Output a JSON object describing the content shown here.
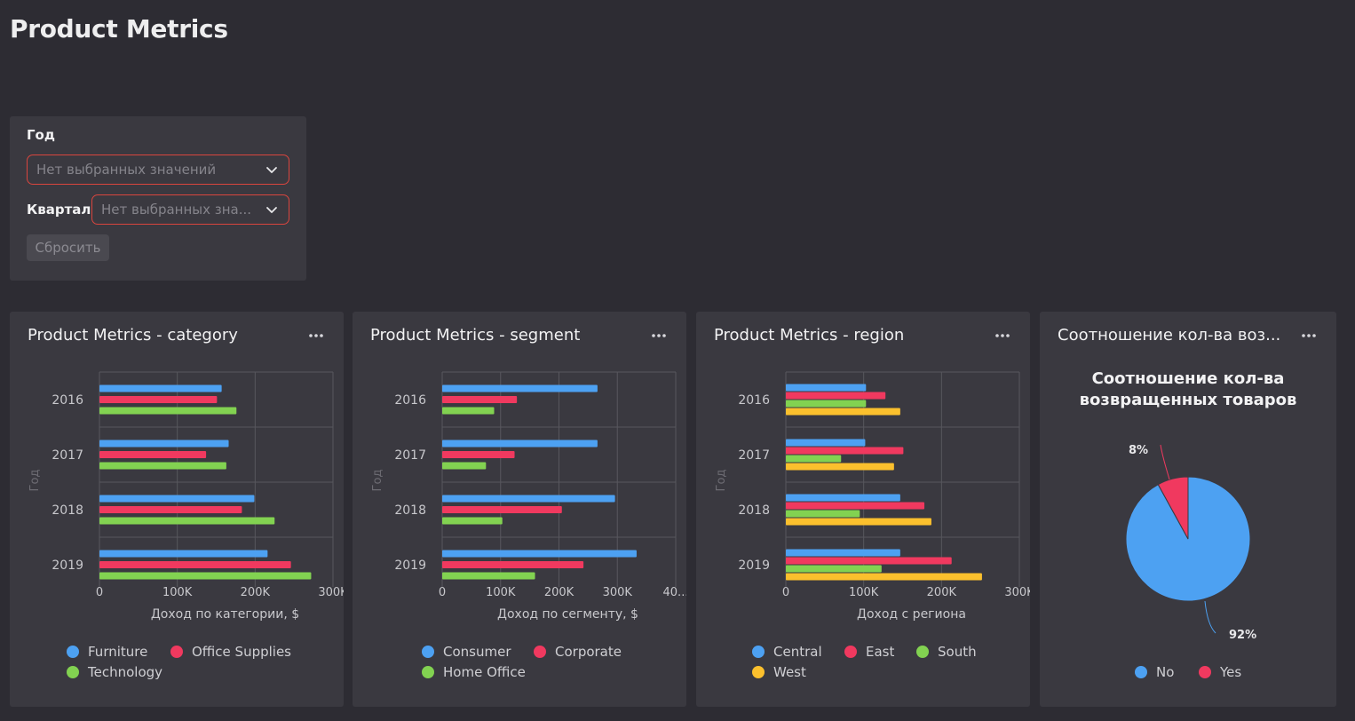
{
  "page": {
    "title": "Product Metrics"
  },
  "filters": {
    "year_label": "Год",
    "year_placeholder": "Нет выбранных значений",
    "quarter_label": "Квартал",
    "quarter_placeholder": "Нет выбранных зна...",
    "reset_label": "Сбросить"
  },
  "cards": {
    "category": {
      "title": "Product Metrics - category"
    },
    "segment": {
      "title": "Product Metrics - segment"
    },
    "region": {
      "title": "Product Metrics - region"
    },
    "returns": {
      "title": "Соотношение кол-ва воз..."
    }
  },
  "colors": {
    "blue": "#4da1f2",
    "red": "#f0395f",
    "green": "#82d251",
    "yellow": "#fbc02d",
    "grid": "#58575e",
    "axis_text": "#c8c8cc",
    "ylabel_text": "#6d6c73"
  },
  "chart_data": [
    {
      "id": "category",
      "type": "bar",
      "orientation": "horizontal",
      "categories": [
        "2016",
        "2017",
        "2018",
        "2019"
      ],
      "series": [
        {
          "name": "Furniture",
          "color": "#4da1f2",
          "values": [
            157000,
            166000,
            199000,
            216000
          ]
        },
        {
          "name": "Office Supplies",
          "color": "#f0395f",
          "values": [
            151000,
            137000,
            183000,
            246000
          ]
        },
        {
          "name": "Technology",
          "color": "#82d251",
          "values": [
            176000,
            163000,
            225000,
            272000
          ]
        }
      ],
      "xlabel": "Доход по категории, $",
      "ylabel": "Год",
      "xlim": [
        0,
        300000
      ],
      "xticks": [
        "0",
        "100K",
        "200K",
        "300K"
      ],
      "grid": true,
      "legend_position": "bottom"
    },
    {
      "id": "segment",
      "type": "bar",
      "orientation": "horizontal",
      "categories": [
        "2016",
        "2017",
        "2018",
        "2019"
      ],
      "series": [
        {
          "name": "Consumer",
          "color": "#4da1f2",
          "values": [
            266000,
            266000,
            296000,
            333000
          ]
        },
        {
          "name": "Corporate",
          "color": "#f0395f",
          "values": [
            128000,
            124000,
            205000,
            242000
          ]
        },
        {
          "name": "Home Office",
          "color": "#82d251",
          "values": [
            89000,
            75000,
            103000,
            159000
          ]
        }
      ],
      "xlabel": "Доход по сегменту, $",
      "ylabel": "Год",
      "xlim": [
        0,
        400000
      ],
      "xticks": [
        "0",
        "100K",
        "200K",
        "300K",
        "40..."
      ],
      "grid": true,
      "legend_position": "bottom"
    },
    {
      "id": "region",
      "type": "bar",
      "orientation": "horizontal",
      "categories": [
        "2016",
        "2017",
        "2018",
        "2019"
      ],
      "series": [
        {
          "name": "Central",
          "color": "#4da1f2",
          "values": [
            103000,
            102000,
            147000,
            147000
          ]
        },
        {
          "name": "East",
          "color": "#f0395f",
          "values": [
            128000,
            151000,
            178000,
            213000
          ]
        },
        {
          "name": "South",
          "color": "#82d251",
          "values": [
            103000,
            71000,
            95000,
            123000
          ]
        },
        {
          "name": "West",
          "color": "#fbc02d",
          "values": [
            147000,
            139000,
            187000,
            252000
          ]
        }
      ],
      "xlabel": "Доход с региона",
      "ylabel": "Год",
      "xlim": [
        0,
        300000
      ],
      "xticks": [
        "0",
        "100K",
        "200K",
        "300K"
      ],
      "grid": true,
      "legend_position": "bottom"
    },
    {
      "id": "returns",
      "type": "pie",
      "title": "Соотношение кол-ва возвращенных товаров",
      "title_lines": [
        "Соотношение кол-ва",
        "возвращенных товаров"
      ],
      "categories": [
        "No",
        "Yes"
      ],
      "values": [
        92,
        8
      ],
      "labels": [
        "92%",
        "8%"
      ],
      "colors": [
        "#4da1f2",
        "#f0395f"
      ],
      "legend_position": "bottom"
    }
  ]
}
